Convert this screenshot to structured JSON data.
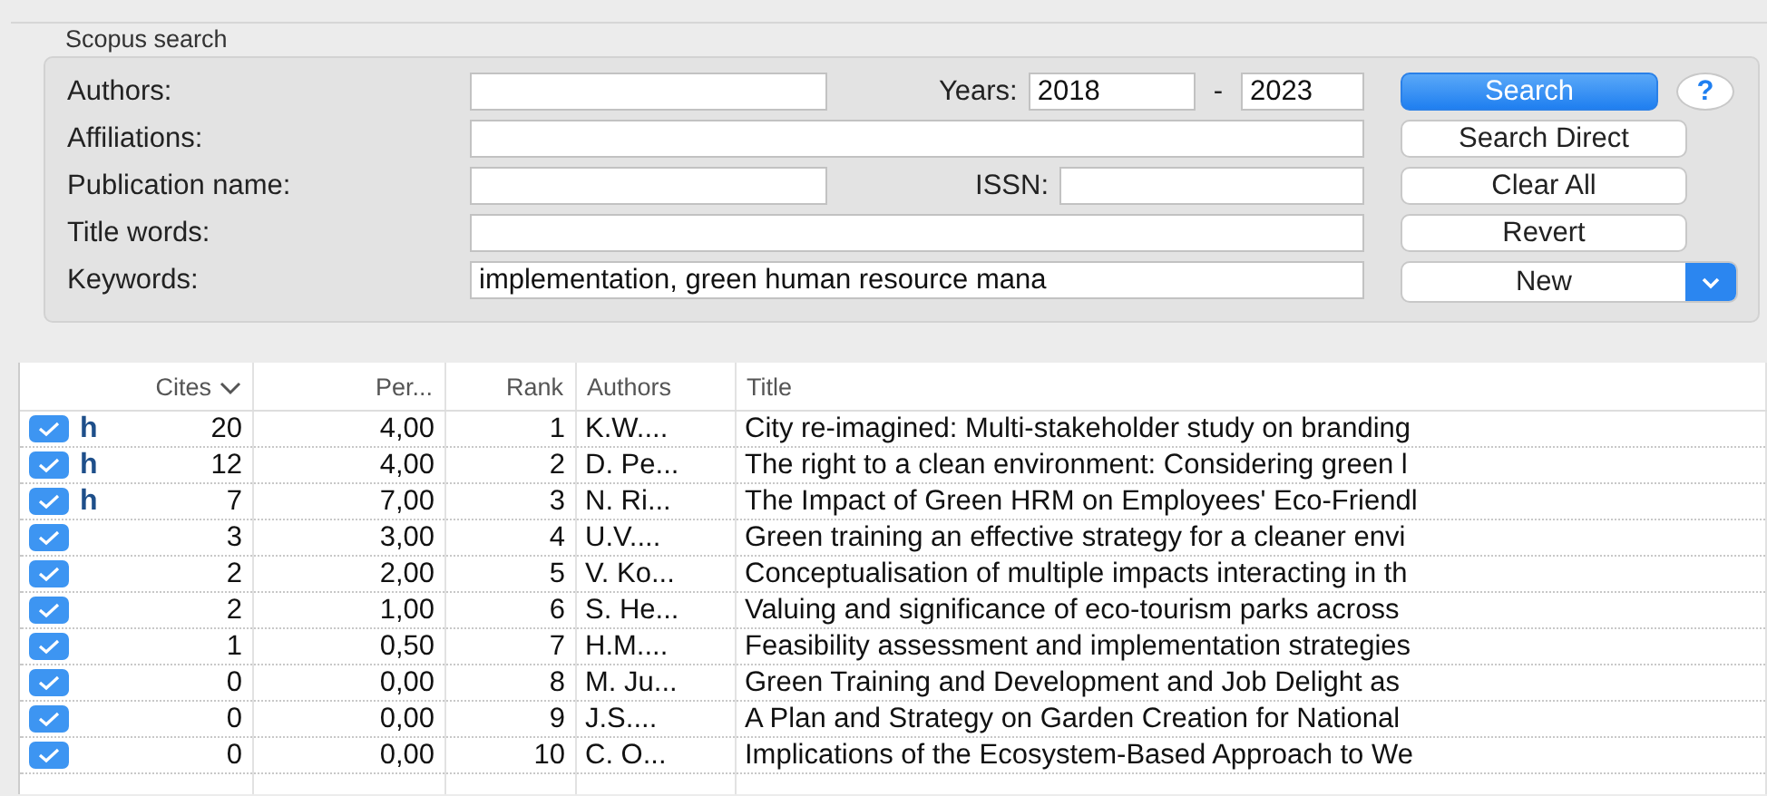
{
  "search": {
    "title": "Scopus search",
    "fields": [
      {
        "label": "Authors:",
        "side": {
          "kind": "years",
          "label": "Years:",
          "from": "2018",
          "separator": "-",
          "to": "2023"
        }
      },
      {
        "label": "Affiliations:"
      },
      {
        "label": "Publication name:",
        "side": {
          "kind": "field",
          "label": "ISSN:"
        }
      },
      {
        "label": "Title words:"
      },
      {
        "label": "Keywords:",
        "value": "implementation, green human resource mana"
      }
    ],
    "buttons": [
      {
        "label": "Search",
        "kind": "primary"
      },
      {
        "label": "Search Direct",
        "kind": "plain"
      },
      {
        "label": "Clear All",
        "kind": "plain"
      },
      {
        "label": "Revert",
        "kind": "plain"
      },
      {
        "label": "New",
        "kind": "popup"
      }
    ],
    "help": "?"
  },
  "table": {
    "columns": [
      {
        "label": "Cites",
        "sorted": true
      },
      {
        "label": "Per...",
        "sorted": false
      },
      {
        "label": "Rank",
        "sorted": false
      },
      {
        "label": "Authors",
        "sorted": false
      },
      {
        "label": "Title",
        "sorted": false
      }
    ],
    "rows": [
      {
        "checked": true,
        "h_mark": "h",
        "cites": "20",
        "per_year": "4,00",
        "rank": "1",
        "authors": "K.W....",
        "title": "City re-imagined: Multi-stakeholder study on branding"
      },
      {
        "checked": true,
        "h_mark": "h",
        "cites": "12",
        "per_year": "4,00",
        "rank": "2",
        "authors": "D. Pe...",
        "title": "The right to a clean environment: Considering green l"
      },
      {
        "checked": true,
        "h_mark": "h",
        "cites": "7",
        "per_year": "7,00",
        "rank": "3",
        "authors": "N. Ri...",
        "title": "The Impact of Green HRM on Employees' Eco-Friendl"
      },
      {
        "checked": true,
        "cites": "3",
        "per_year": "3,00",
        "rank": "4",
        "authors": "U.V....",
        "title": "Green training an effective strategy for a cleaner envi"
      },
      {
        "checked": true,
        "cites": "2",
        "per_year": "2,00",
        "rank": "5",
        "authors": "V. Ko...",
        "title": "Conceptualisation of multiple impacts interacting in th"
      },
      {
        "checked": true,
        "cites": "2",
        "per_year": "1,00",
        "rank": "6",
        "authors": "S. He...",
        "title": "Valuing and significance of eco-tourism parks across"
      },
      {
        "checked": true,
        "cites": "1",
        "per_year": "0,50",
        "rank": "7",
        "authors": "H.M....",
        "title": "Feasibility assessment and implementation strategies"
      },
      {
        "checked": true,
        "cites": "0",
        "per_year": "0,00",
        "rank": "8",
        "authors": "M. Ju...",
        "title": "Green Training and Development and Job Delight as"
      },
      {
        "checked": true,
        "cites": "0",
        "per_year": "0,00",
        "rank": "9",
        "authors": "J.S....",
        "title": "A Plan and Strategy on Garden Creation for National"
      },
      {
        "checked": true,
        "cites": "0",
        "per_year": "0,00",
        "rank": "10",
        "authors": "C. O...",
        "title": "Implications of the Ecosystem-Based Approach to We"
      }
    ]
  }
}
